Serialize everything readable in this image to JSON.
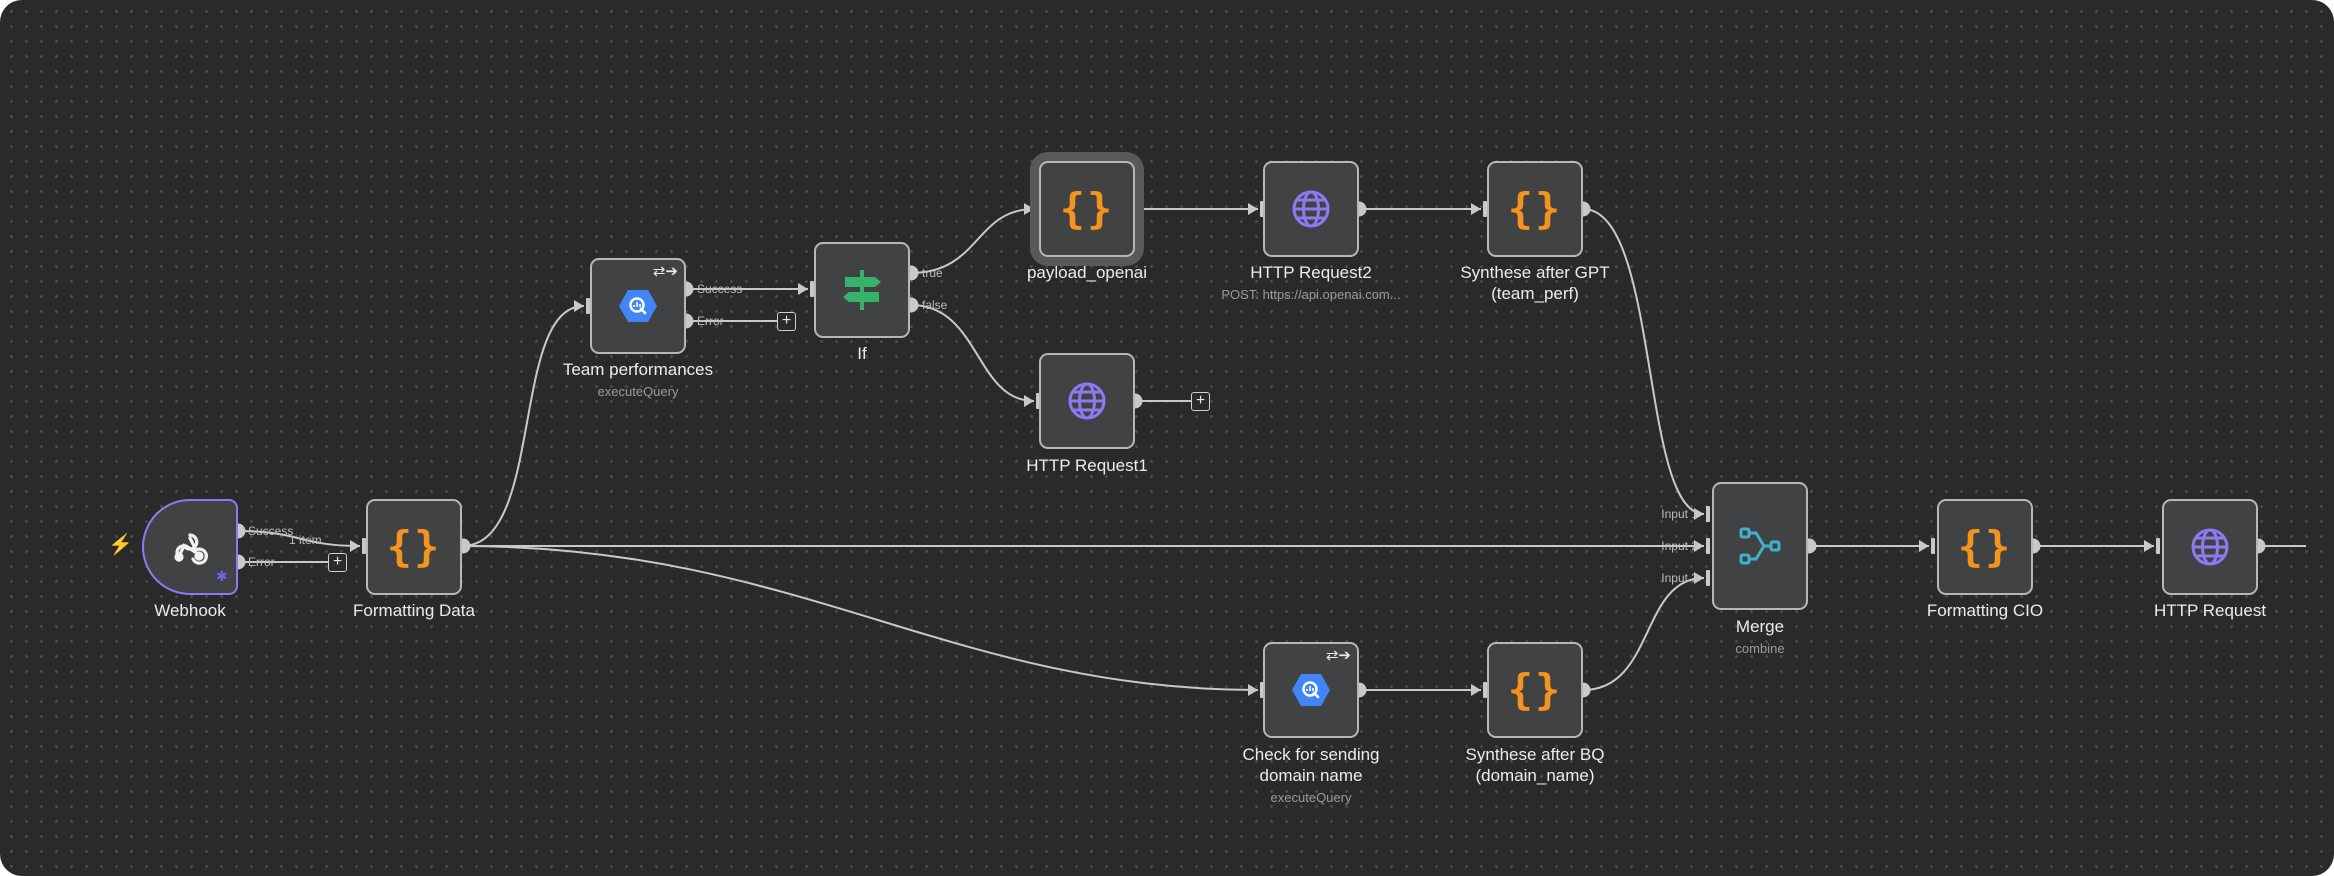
{
  "nodes": {
    "webhook": {
      "label": "Webhook",
      "port_success": "Success",
      "port_error": "Error",
      "item_count": "1 item"
    },
    "formatting_data": {
      "label": "Formatting Data"
    },
    "team_performances": {
      "label": "Team performances",
      "subtitle": "executeQuery",
      "port_success": "Success",
      "port_error": "Error"
    },
    "if_node": {
      "label": "If",
      "port_true": "true",
      "port_false": "false"
    },
    "payload_openai": {
      "label": "payload_openai"
    },
    "http_request1": {
      "label": "HTTP Request1"
    },
    "http_request2": {
      "label": "HTTP Request2",
      "subtitle": "POST: https://api.openai.com..."
    },
    "synthese_gpt": {
      "label_line1": "Synthese after GPT",
      "label_line2": "(team_perf)"
    },
    "check_domain": {
      "label_line1": "Check for sending",
      "label_line2": "domain name",
      "subtitle": "executeQuery"
    },
    "synthese_bq": {
      "label_line1": "Synthese after BQ",
      "label_line2": "(domain_name)"
    },
    "merge": {
      "label": "Merge",
      "subtitle": "combine",
      "input1": "Input 1",
      "input2": "Input 2",
      "input3": "Input 3"
    },
    "formatting_cio": {
      "label": "Formatting CIO"
    },
    "http_request": {
      "label": "HTTP Request"
    }
  },
  "colors": {
    "canvas": "#2a2a2b",
    "node": "#414244",
    "edge": "#c9c9cb",
    "code": "#f4941e",
    "http": "#8a7cf0",
    "bigquery": "#4285f4",
    "if": "#35b368",
    "merge": "#3fb1c9",
    "trigger": "#ff5a52"
  },
  "icons": {
    "code": "code-braces-icon",
    "http": "globe-icon",
    "bigquery": "bigquery-hexagon-icon",
    "if": "signpost-icon",
    "merge": "merge-icon",
    "webhook": "webhook-icon"
  }
}
